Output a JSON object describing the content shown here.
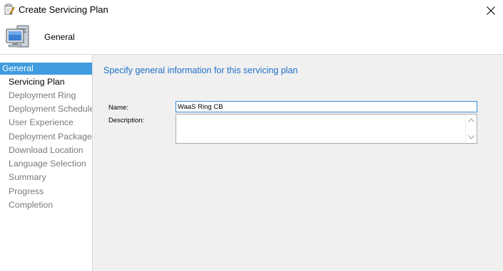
{
  "window": {
    "title": "Create Servicing Plan",
    "title_icon": "wizard-edit-icon",
    "close_icon": "close-icon"
  },
  "header": {
    "title": "General",
    "icon": "computer-icon"
  },
  "sidebar": {
    "items": [
      {
        "label": "General",
        "state": "selected"
      },
      {
        "label": "Servicing Plan",
        "state": "current"
      },
      {
        "label": "Deployment Ring",
        "state": "normal"
      },
      {
        "label": "Deployment Schedule",
        "state": "normal"
      },
      {
        "label": "User Experience",
        "state": "normal"
      },
      {
        "label": "Deployment Package",
        "state": "normal"
      },
      {
        "label": "Download Location",
        "state": "normal"
      },
      {
        "label": "Language Selection",
        "state": "normal"
      },
      {
        "label": "Summary",
        "state": "normal"
      },
      {
        "label": "Progress",
        "state": "normal"
      },
      {
        "label": "Completion",
        "state": "normal"
      }
    ]
  },
  "main": {
    "heading": "Specify general information for this servicing plan",
    "name_label": "Name:",
    "name_value": "WaaS Ring CB",
    "description_label": "Description:",
    "description_value": ""
  },
  "colors": {
    "selection": "#3f9cde",
    "heading": "#1e70c8",
    "panel": "#f0f0f0",
    "input_focus_border": "#3a8fd8"
  }
}
